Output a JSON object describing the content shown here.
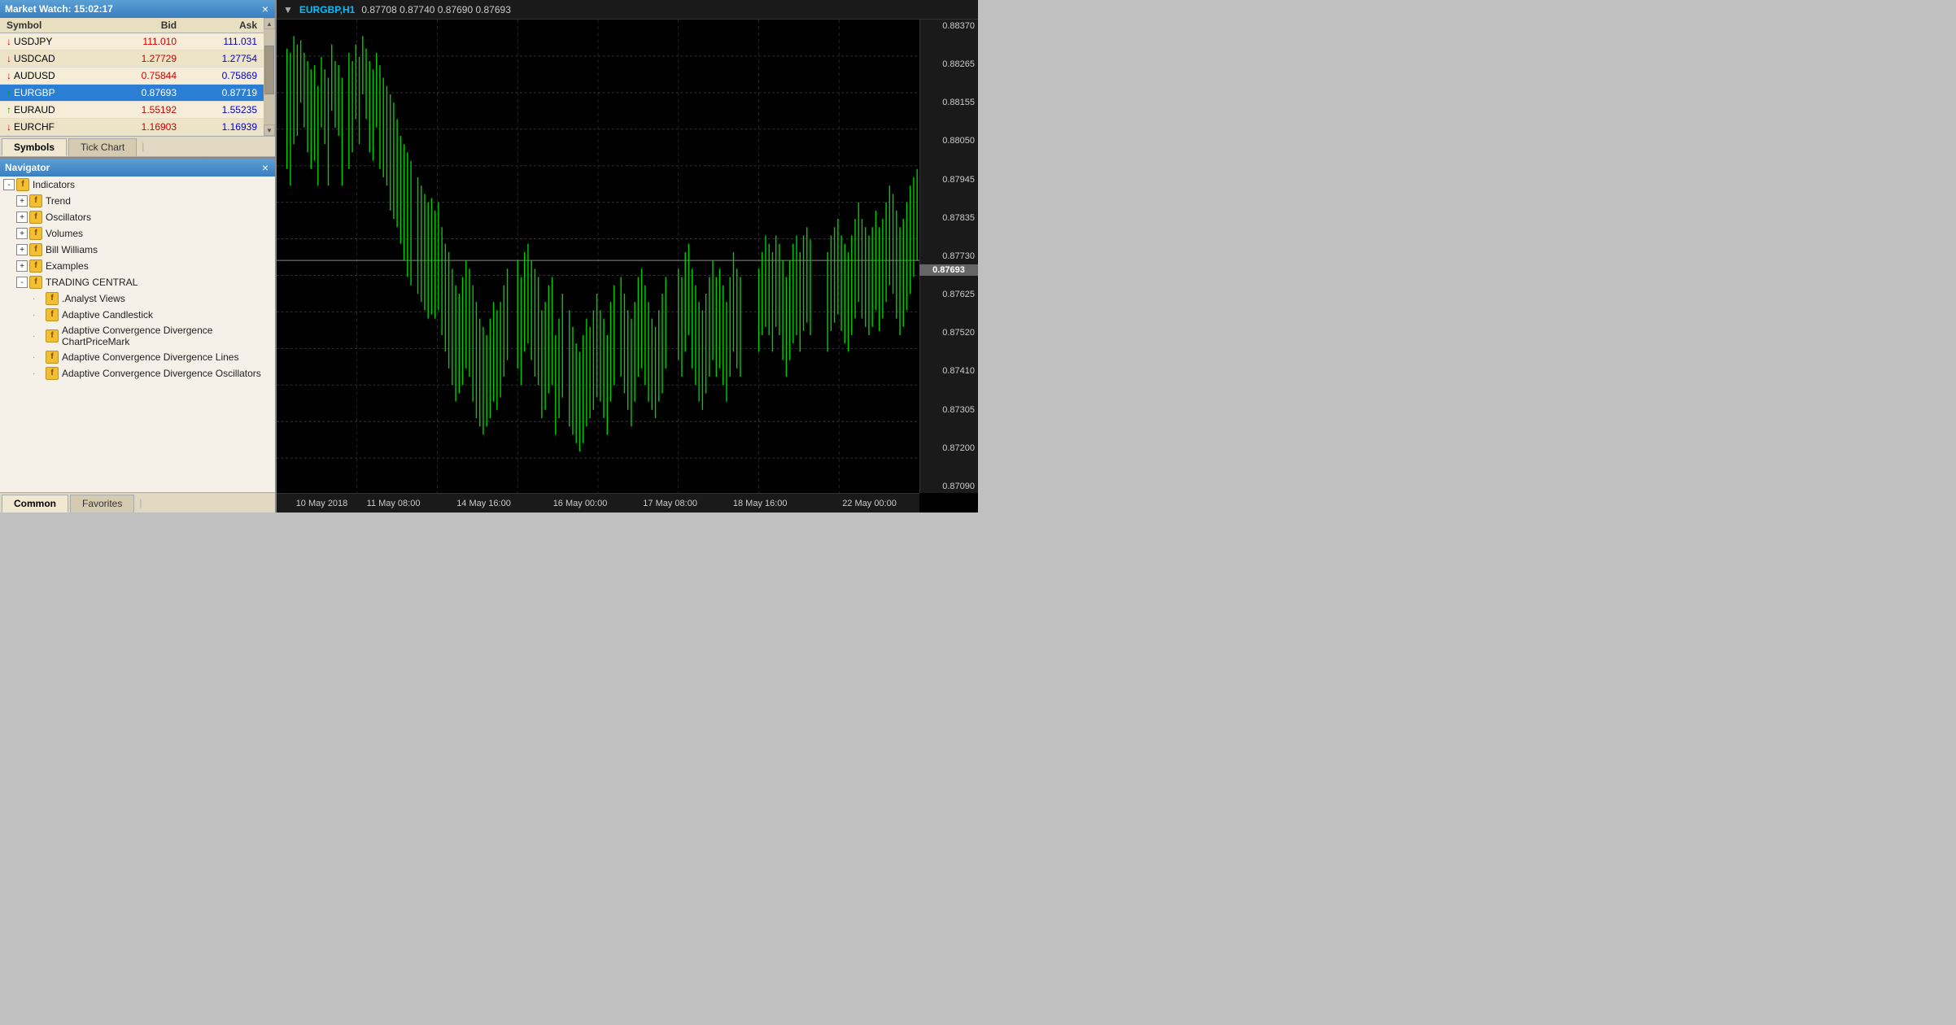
{
  "market_watch": {
    "title": "Market Watch: 15:02:17",
    "columns": [
      "Symbol",
      "Bid",
      "Ask"
    ],
    "rows": [
      {
        "symbol": "USDJPY",
        "bid": "111.010",
        "ask": "111.031",
        "direction": "down",
        "selected": false
      },
      {
        "symbol": "USDCAD",
        "bid": "1.27729",
        "ask": "1.27754",
        "direction": "down",
        "selected": false
      },
      {
        "symbol": "AUDUSD",
        "bid": "0.75844",
        "ask": "0.75869",
        "direction": "down",
        "selected": false
      },
      {
        "symbol": "EURGBP",
        "bid": "0.87693",
        "ask": "0.87719",
        "direction": "up",
        "selected": true
      },
      {
        "symbol": "EURAUD",
        "bid": "1.55192",
        "ask": "1.55235",
        "direction": "up",
        "selected": false
      },
      {
        "symbol": "EURCHF",
        "bid": "1.16903",
        "ask": "1.16939",
        "direction": "down",
        "selected": false
      }
    ],
    "tabs": [
      "Symbols",
      "Tick Chart"
    ]
  },
  "navigator": {
    "title": "Navigator",
    "tree": [
      {
        "label": "Indicators",
        "level": 0,
        "expand": "-",
        "has_icon": true
      },
      {
        "label": "Trend",
        "level": 1,
        "expand": "+",
        "has_icon": true
      },
      {
        "label": "Oscillators",
        "level": 1,
        "expand": "+",
        "has_icon": true
      },
      {
        "label": "Volumes",
        "level": 1,
        "expand": "+",
        "has_icon": true
      },
      {
        "label": "Bill Williams",
        "level": 1,
        "expand": "+",
        "has_icon": true
      },
      {
        "label": "Examples",
        "level": 1,
        "expand": "+",
        "has_icon": true
      },
      {
        "label": "TRADING CENTRAL",
        "level": 1,
        "expand": "-",
        "has_icon": true
      },
      {
        "label": ".Analyst Views",
        "level": 2,
        "expand": null,
        "has_icon": true
      },
      {
        "label": "Adaptive Candlestick",
        "level": 2,
        "expand": null,
        "has_icon": true
      },
      {
        "label": "Adaptive Convergence Divergence ChartPriceMark",
        "level": 2,
        "expand": null,
        "has_icon": true
      },
      {
        "label": "Adaptive Convergence Divergence Lines",
        "level": 2,
        "expand": null,
        "has_icon": true
      },
      {
        "label": "Adaptive Convergence Divergence Oscillators",
        "level": 2,
        "expand": null,
        "has_icon": true
      }
    ],
    "tabs": [
      "Common",
      "Favorites"
    ]
  },
  "chart": {
    "symbol": "EURGBP,H1",
    "prices_header": "0.87708  0.87740  0.87690  0.87693",
    "price_levels": [
      "0.88370",
      "0.88265",
      "0.88155",
      "0.88050",
      "0.87945",
      "0.87835",
      "0.87730",
      "0.87625",
      "0.87520",
      "0.87410",
      "0.87305",
      "0.87200",
      "0.87090"
    ],
    "current_price": "0.87693",
    "time_labels": [
      {
        "label": "10 May 2018",
        "pos_pct": 3
      },
      {
        "label": "11 May 08:00",
        "pos_pct": 14
      },
      {
        "label": "14 May 16:00",
        "pos_pct": 28
      },
      {
        "label": "16 May 00:00",
        "pos_pct": 43
      },
      {
        "label": "17 May 08:00",
        "pos_pct": 57
      },
      {
        "label": "18 May 16:00",
        "pos_pct": 71
      },
      {
        "label": "22 May 00:00",
        "pos_pct": 88
      }
    ]
  }
}
